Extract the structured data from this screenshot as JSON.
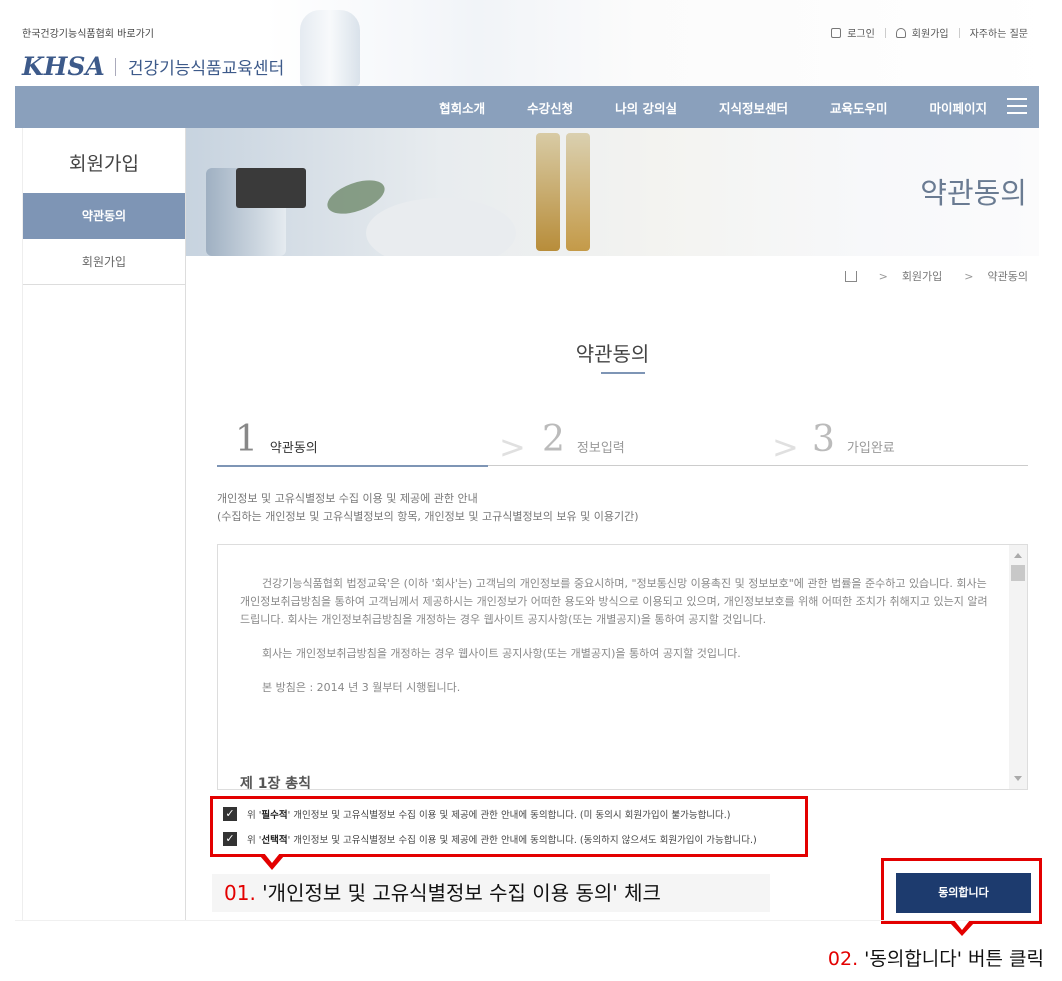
{
  "header": {
    "kfa_link": "한국건강기능식품협회 바로가기",
    "logo_mark": "KHSA",
    "logo_text": "건강기능식품교육센터",
    "util_links": [
      "로그인",
      "회원가입",
      "자주하는 질문"
    ]
  },
  "nav": {
    "items": [
      "협회소개",
      "수강신청",
      "나의 강의실",
      "지식정보센터",
      "교육도우미",
      "마이페이지"
    ]
  },
  "sidebar": {
    "title": "회원가입",
    "items": [
      {
        "label": "약관동의",
        "active": true
      },
      {
        "label": "회원가입",
        "active": false
      }
    ]
  },
  "banner": {
    "title": "약관동의"
  },
  "breadcrumb": [
    "회원가입",
    "약관동의"
  ],
  "page": {
    "heading": "약관동의"
  },
  "steps": [
    {
      "num": "1",
      "label": "약관동의",
      "active": true
    },
    {
      "num": "2",
      "label": "정보입력",
      "active": false
    },
    {
      "num": "3",
      "label": "가입완료",
      "active": false
    }
  ],
  "notice": {
    "line1": "개인정보 및 고유식별정보 수집 이용 및 제공에 관한 안내",
    "line2": "(수집하는 개인정보 및 고유식별정보의 항목, 개인정보 및 고규식별정보의 보유 및 이용기간)"
  },
  "terms": {
    "p1": "건강기능식품협회 법정교육'은 (이하 '회사'는) 고객님의 개인정보를 중요시하며, \"정보통신망 이용촉진 및 정보보호\"에 관한 법률을 준수하고 있습니다. 회사는 개인정보취급방침을 통하여 고객님께서 제공하시는 개인정보가 어떠한 용도와 방식으로 이용되고 있으며, 개인정보보호를 위해 어떠한 조치가 취해지고 있는지 알려드립니다. 회사는 개인정보취급방침을 개정하는 경우 웹사이트 공지사항(또는 개별공지)을 통하여 공지할 것입니다.",
    "p2": "회사는 개인정보취급방침을 개정하는 경우 웹사이트 공지사항(또는 개별공지)을 통하여 공지할 것입니다.",
    "p3": "본 방침은 : 2014 년 3 월부터 시행됩니다.",
    "chapter": "제 1장 총칙"
  },
  "checks": {
    "c1_pre": "위 '",
    "c1_bold": "필수적",
    "c1_post": "' 개인정보 및 고유식별정보 수집 이용 및 제공에 관한 안내에 동의합니다. (미 동의시 회원가입이 불가능합니다.)",
    "c2_pre": "위 '",
    "c2_bold": "선택적",
    "c2_post": "' 개인정보 및 고유식별정보 수집 이용 및 제공에 관한 안내에 동의합니다. (동의하지 않으셔도 회원가입이 가능합니다.)",
    "mark": "✓"
  },
  "annotations": {
    "a1_num": "01.",
    "a1_text": " '개인정보 및 고유식별정보 수집 이용 동의' 체크",
    "a2_num": "02.",
    "a2_text": " '동의합니다' 버튼 클릭"
  },
  "agree_button": "동의합니다",
  "colors": {
    "nav": "#8aa0bc",
    "sidebar_active": "#7e95b5",
    "button": "#1d3b6e",
    "highlight": "#e30000"
  }
}
